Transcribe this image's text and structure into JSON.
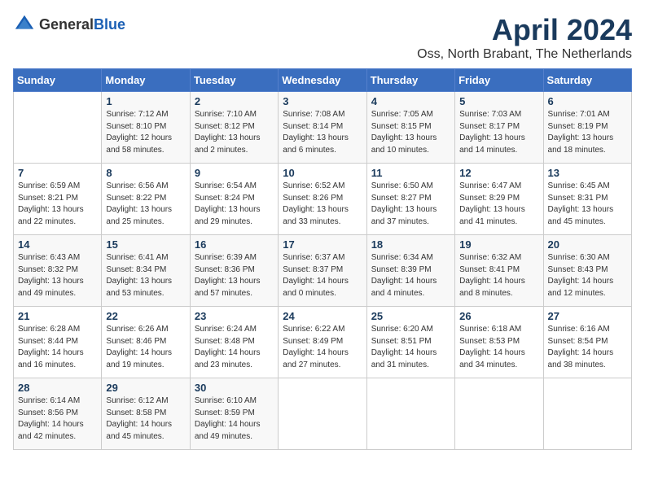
{
  "header": {
    "logo_general": "General",
    "logo_blue": "Blue",
    "month_title": "April 2024",
    "location": "Oss, North Brabant, The Netherlands"
  },
  "weekdays": [
    "Sunday",
    "Monday",
    "Tuesday",
    "Wednesday",
    "Thursday",
    "Friday",
    "Saturday"
  ],
  "weeks": [
    [
      {
        "day": "",
        "info": ""
      },
      {
        "day": "1",
        "info": "Sunrise: 7:12 AM\nSunset: 8:10 PM\nDaylight: 12 hours\nand 58 minutes."
      },
      {
        "day": "2",
        "info": "Sunrise: 7:10 AM\nSunset: 8:12 PM\nDaylight: 13 hours\nand 2 minutes."
      },
      {
        "day": "3",
        "info": "Sunrise: 7:08 AM\nSunset: 8:14 PM\nDaylight: 13 hours\nand 6 minutes."
      },
      {
        "day": "4",
        "info": "Sunrise: 7:05 AM\nSunset: 8:15 PM\nDaylight: 13 hours\nand 10 minutes."
      },
      {
        "day": "5",
        "info": "Sunrise: 7:03 AM\nSunset: 8:17 PM\nDaylight: 13 hours\nand 14 minutes."
      },
      {
        "day": "6",
        "info": "Sunrise: 7:01 AM\nSunset: 8:19 PM\nDaylight: 13 hours\nand 18 minutes."
      }
    ],
    [
      {
        "day": "7",
        "info": "Sunrise: 6:59 AM\nSunset: 8:21 PM\nDaylight: 13 hours\nand 22 minutes."
      },
      {
        "day": "8",
        "info": "Sunrise: 6:56 AM\nSunset: 8:22 PM\nDaylight: 13 hours\nand 25 minutes."
      },
      {
        "day": "9",
        "info": "Sunrise: 6:54 AM\nSunset: 8:24 PM\nDaylight: 13 hours\nand 29 minutes."
      },
      {
        "day": "10",
        "info": "Sunrise: 6:52 AM\nSunset: 8:26 PM\nDaylight: 13 hours\nand 33 minutes."
      },
      {
        "day": "11",
        "info": "Sunrise: 6:50 AM\nSunset: 8:27 PM\nDaylight: 13 hours\nand 37 minutes."
      },
      {
        "day": "12",
        "info": "Sunrise: 6:47 AM\nSunset: 8:29 PM\nDaylight: 13 hours\nand 41 minutes."
      },
      {
        "day": "13",
        "info": "Sunrise: 6:45 AM\nSunset: 8:31 PM\nDaylight: 13 hours\nand 45 minutes."
      }
    ],
    [
      {
        "day": "14",
        "info": "Sunrise: 6:43 AM\nSunset: 8:32 PM\nDaylight: 13 hours\nand 49 minutes."
      },
      {
        "day": "15",
        "info": "Sunrise: 6:41 AM\nSunset: 8:34 PM\nDaylight: 13 hours\nand 53 minutes."
      },
      {
        "day": "16",
        "info": "Sunrise: 6:39 AM\nSunset: 8:36 PM\nDaylight: 13 hours\nand 57 minutes."
      },
      {
        "day": "17",
        "info": "Sunrise: 6:37 AM\nSunset: 8:37 PM\nDaylight: 14 hours\nand 0 minutes."
      },
      {
        "day": "18",
        "info": "Sunrise: 6:34 AM\nSunset: 8:39 PM\nDaylight: 14 hours\nand 4 minutes."
      },
      {
        "day": "19",
        "info": "Sunrise: 6:32 AM\nSunset: 8:41 PM\nDaylight: 14 hours\nand 8 minutes."
      },
      {
        "day": "20",
        "info": "Sunrise: 6:30 AM\nSunset: 8:43 PM\nDaylight: 14 hours\nand 12 minutes."
      }
    ],
    [
      {
        "day": "21",
        "info": "Sunrise: 6:28 AM\nSunset: 8:44 PM\nDaylight: 14 hours\nand 16 minutes."
      },
      {
        "day": "22",
        "info": "Sunrise: 6:26 AM\nSunset: 8:46 PM\nDaylight: 14 hours\nand 19 minutes."
      },
      {
        "day": "23",
        "info": "Sunrise: 6:24 AM\nSunset: 8:48 PM\nDaylight: 14 hours\nand 23 minutes."
      },
      {
        "day": "24",
        "info": "Sunrise: 6:22 AM\nSunset: 8:49 PM\nDaylight: 14 hours\nand 27 minutes."
      },
      {
        "day": "25",
        "info": "Sunrise: 6:20 AM\nSunset: 8:51 PM\nDaylight: 14 hours\nand 31 minutes."
      },
      {
        "day": "26",
        "info": "Sunrise: 6:18 AM\nSunset: 8:53 PM\nDaylight: 14 hours\nand 34 minutes."
      },
      {
        "day": "27",
        "info": "Sunrise: 6:16 AM\nSunset: 8:54 PM\nDaylight: 14 hours\nand 38 minutes."
      }
    ],
    [
      {
        "day": "28",
        "info": "Sunrise: 6:14 AM\nSunset: 8:56 PM\nDaylight: 14 hours\nand 42 minutes."
      },
      {
        "day": "29",
        "info": "Sunrise: 6:12 AM\nSunset: 8:58 PM\nDaylight: 14 hours\nand 45 minutes."
      },
      {
        "day": "30",
        "info": "Sunrise: 6:10 AM\nSunset: 8:59 PM\nDaylight: 14 hours\nand 49 minutes."
      },
      {
        "day": "",
        "info": ""
      },
      {
        "day": "",
        "info": ""
      },
      {
        "day": "",
        "info": ""
      },
      {
        "day": "",
        "info": ""
      }
    ]
  ]
}
